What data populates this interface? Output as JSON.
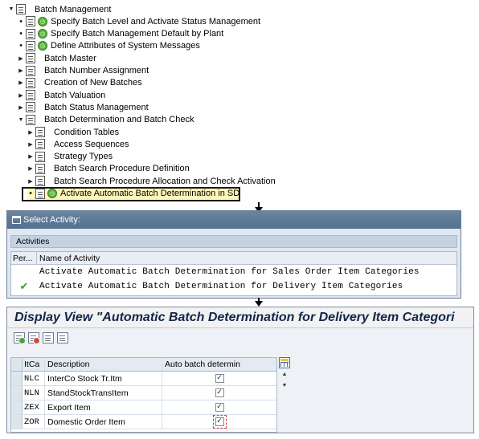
{
  "tree": {
    "items": [
      {
        "label": "Batch Management",
        "level": 0,
        "expanded": true,
        "exec": false
      },
      {
        "label": "Specify Batch Level and Activate Status Management",
        "level": 1,
        "bullet": true,
        "exec": true
      },
      {
        "label": "Specify Batch Management Default by Plant",
        "level": 1,
        "bullet": true,
        "exec": true
      },
      {
        "label": "Define Attributes of System Messages",
        "level": 1,
        "bullet": true,
        "exec": true
      },
      {
        "label": "Batch Master",
        "level": 1,
        "expanded": false,
        "exec": false
      },
      {
        "label": "Batch Number Assignment",
        "level": 1,
        "expanded": false,
        "exec": false
      },
      {
        "label": "Creation of New Batches",
        "level": 1,
        "expanded": false,
        "exec": false
      },
      {
        "label": "Batch Valuation",
        "level": 1,
        "expanded": false,
        "exec": false
      },
      {
        "label": "Batch Status Management",
        "level": 1,
        "expanded": false,
        "exec": false
      },
      {
        "label": "Batch Determination and Batch Check",
        "level": 1,
        "expanded": true,
        "exec": false
      },
      {
        "label": "Condition Tables",
        "level": 2,
        "expanded": false,
        "exec": false
      },
      {
        "label": "Access Sequences",
        "level": 2,
        "expanded": false,
        "exec": false
      },
      {
        "label": "Strategy Types",
        "level": 2,
        "expanded": false,
        "exec": false
      },
      {
        "label": "Batch Search Procedure Definition",
        "level": 2,
        "expanded": false,
        "exec": false
      },
      {
        "label": "Batch Search Procedure Allocation and Check Activation",
        "level": 2,
        "expanded": false,
        "exec": false
      },
      {
        "label": "Activate Automatic Batch Determination in SD",
        "level": 2,
        "bullet": true,
        "exec": true,
        "highlighted": true
      }
    ]
  },
  "select_activity": {
    "title": "Select Activity:",
    "tab": "Activities",
    "col_performed": "Per...",
    "col_name": "Name of Activity",
    "rows": [
      {
        "name": "Activate Automatic Batch Determination for Sales Order Item Categories",
        "done": false
      },
      {
        "name": "Activate Automatic Batch Determination for Delivery Item Categories",
        "done": true
      }
    ],
    "done_mark": "✔"
  },
  "display_view": {
    "title": "Display View \"Automatic Batch Determination for Delivery Item Categori",
    "columns": {
      "itca": "ItCa",
      "description": "Description",
      "auto": "Auto batch determin"
    },
    "rows": [
      {
        "itca": "NLC",
        "description": "InterCo Stock Tr.Itm",
        "checked": true
      },
      {
        "itca": "NLN",
        "description": "StandStockTransItem",
        "checked": true
      },
      {
        "itca": "ZEX",
        "description": "Export Item",
        "checked": true
      },
      {
        "itca": "ZOR",
        "description": "Domestic Order Item",
        "checked": true,
        "highlighted": true
      }
    ],
    "check_mark": "✓",
    "scroll_up": "▲",
    "scroll_down": "▼"
  },
  "icons": {
    "tree_expanded": "▼",
    "tree_collapsed": "▶",
    "tree_bullet": "•",
    "exec": "clock-execute-icon"
  },
  "colors": {
    "highlight": "#fff7b8",
    "title_bar": "#52708e",
    "view_title": "#12264a",
    "done_check": "#3d9a2d",
    "focus_box": "#d13f3f"
  }
}
